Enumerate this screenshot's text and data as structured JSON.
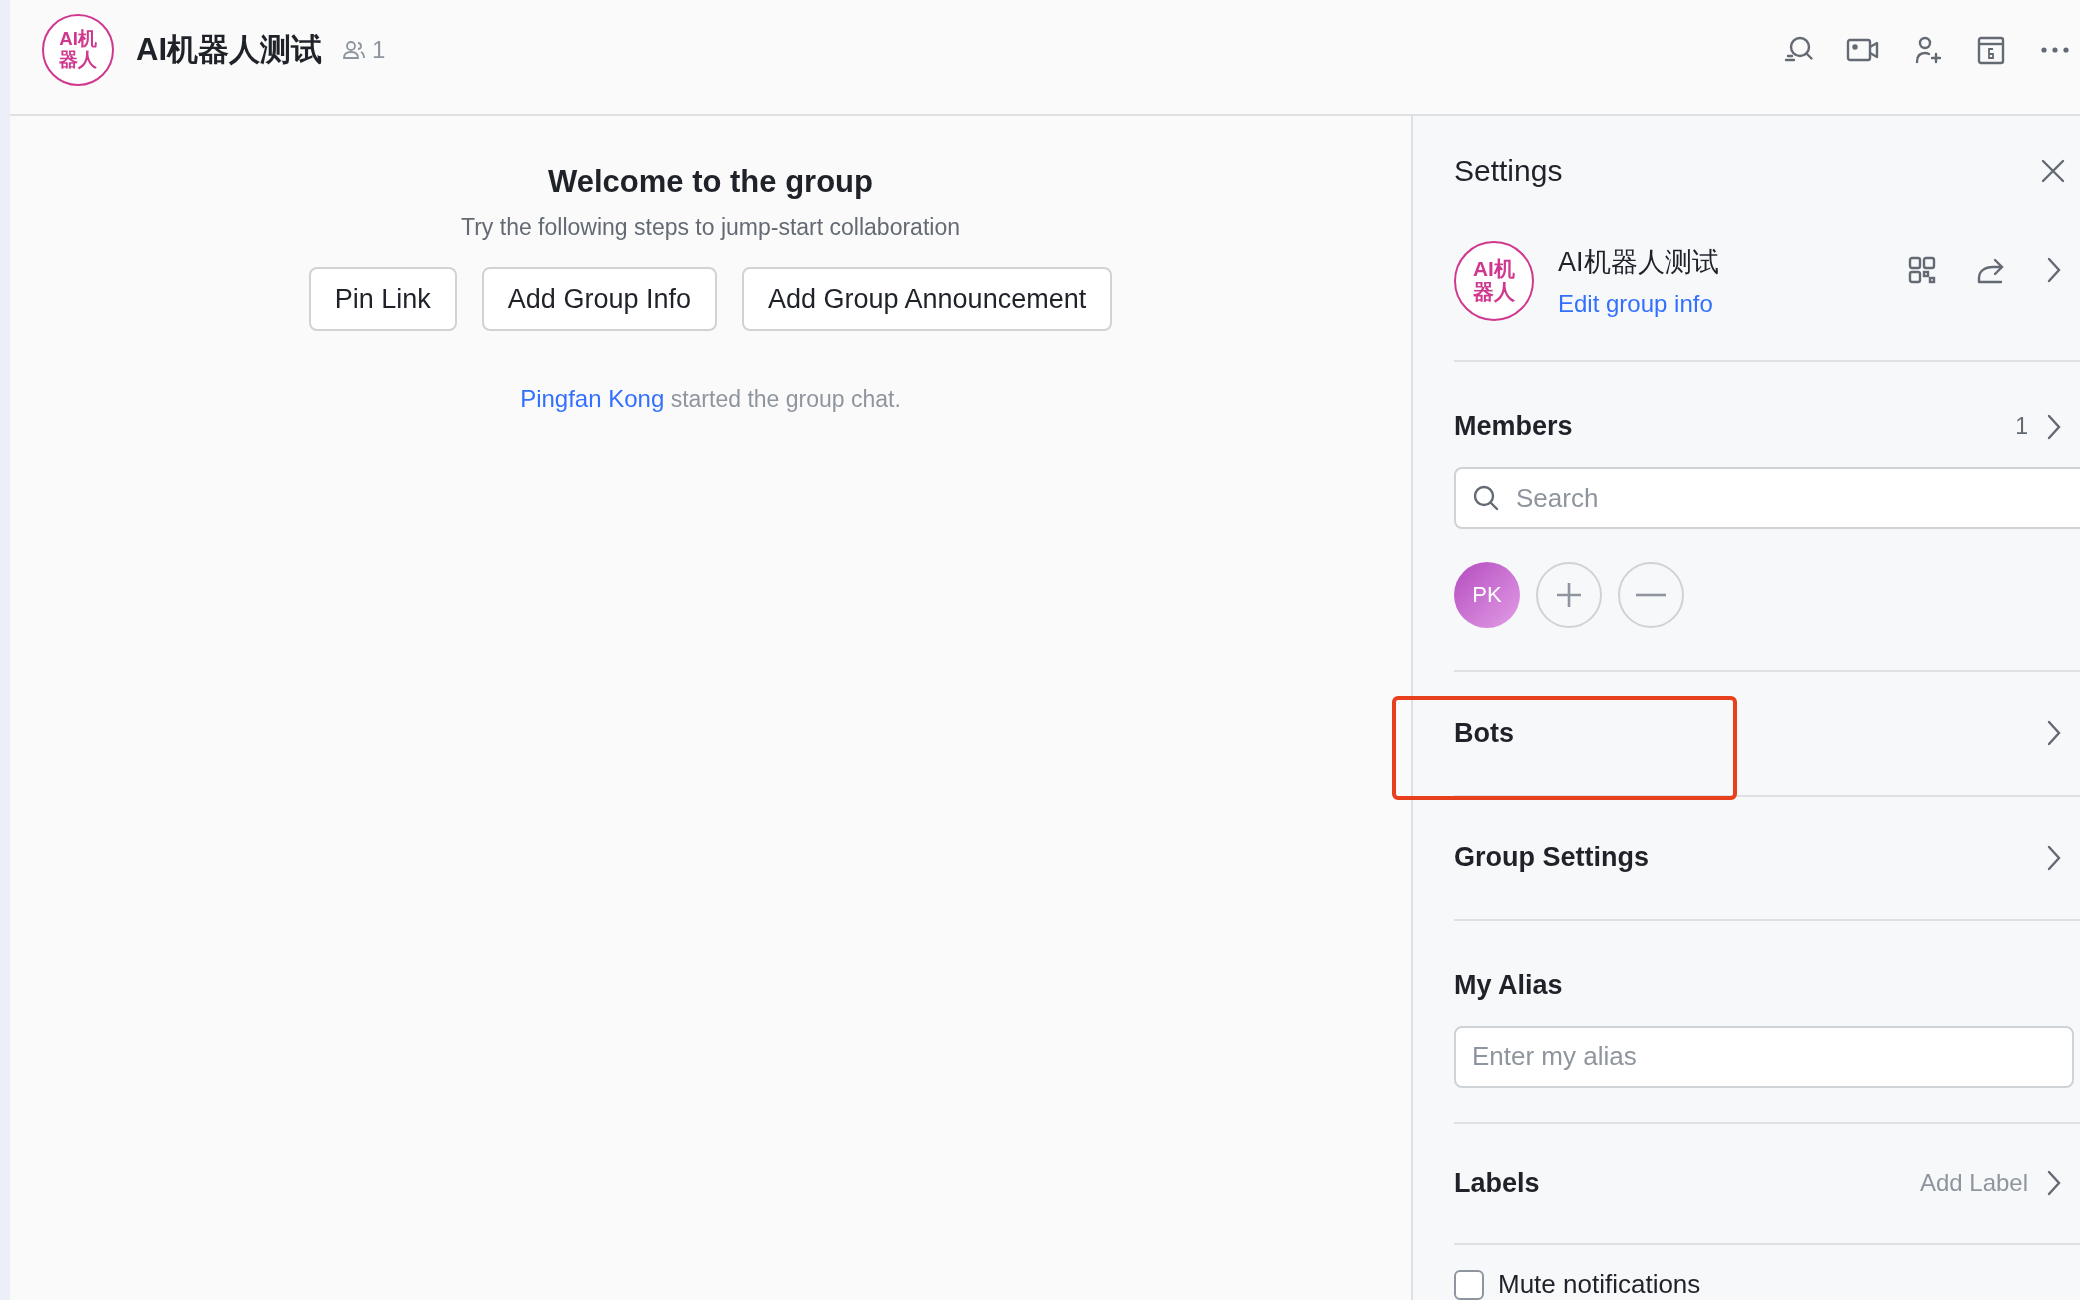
{
  "header": {
    "avatar_text": "AI机器人",
    "title": "AI机器人测试",
    "member_count": "1"
  },
  "welcome": {
    "title": "Welcome to the group",
    "subtitle": "Try the following steps to jump-start collaboration",
    "buttons": [
      "Pin Link",
      "Add Group Info",
      "Add Group Announcement"
    ],
    "system_message": {
      "actor": "Pingfan Kong",
      "text": "started the group chat."
    }
  },
  "settings": {
    "title": "Settings",
    "group": {
      "avatar_text": "AI机器人",
      "name": "AI机器人测试",
      "edit_link": "Edit group info"
    },
    "members": {
      "title": "Members",
      "count": "1",
      "search_placeholder": "Search",
      "list": [
        {
          "initials": "PK"
        }
      ]
    },
    "sections": [
      {
        "title": "Bots",
        "highlighted": true
      },
      {
        "title": "Group Settings",
        "highlighted": false
      }
    ],
    "alias": {
      "title": "My Alias",
      "placeholder": "Enter my alias"
    },
    "labels": {
      "title": "Labels",
      "action": "Add Label"
    },
    "mute": {
      "label": "Mute notifications",
      "checked": false
    }
  }
}
